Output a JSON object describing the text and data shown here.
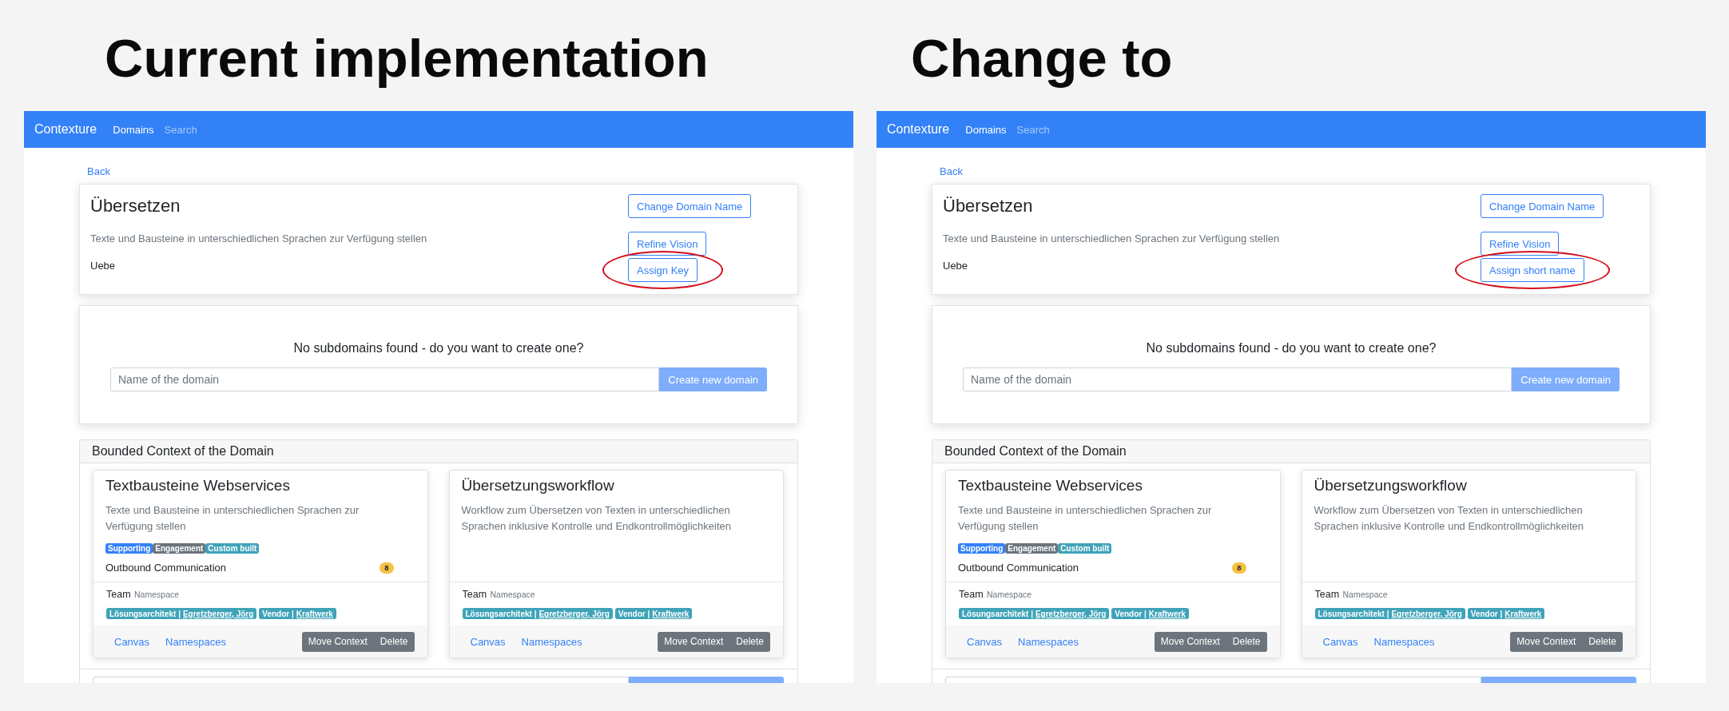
{
  "panels": [
    {
      "heading": "Current implementation",
      "app": {
        "navbar": {
          "brand": "Contexture",
          "links": [
            {
              "label": "Domains",
              "selected": true
            },
            {
              "label": "Search",
              "selected": false
            }
          ]
        },
        "back_link": "Back",
        "domain": {
          "name": "Übersetzen",
          "vision": "Texte und Bausteine in unterschiedlichen Sprachen zur Verfügung stellen",
          "key": "Uebe",
          "actions": [
            {
              "label": "Change Domain Name",
              "highlighted": false
            },
            {
              "label": "Refine Vision",
              "highlighted": false
            },
            {
              "label": "Assign Key",
              "highlighted": true
            }
          ]
        },
        "subdomains": {
          "message": "No subdomains found - do you want to create one?",
          "input": {
            "placeholder": "Name of the domain"
          },
          "create_button": "Create new domain"
        },
        "bounded_contexts": {
          "title": "Bounded Context of the Domain",
          "cards": [
            {
              "name": "Textbausteine Webservices",
              "description": "Texte und Bausteine in unterschiedlichen Sprachen zur Verfügung stellen",
              "badges": [
                {
                  "label": "Supporting",
                  "color": "#3381f7"
                },
                {
                  "label": "Engagement",
                  "color": "#6c757d"
                },
                {
                  "label": "Custom built",
                  "color": "#3fa3b8"
                }
              ],
              "messages": [
                {
                  "label": "Outbound Communication",
                  "count": "8"
                }
              ],
              "team": {
                "label": "Team",
                "caption": "Namespace"
              },
              "namespaces": [
                {
                  "label": "Lösungsarchitekt |",
                  "link": "Egretzberger, Jörg"
                },
                {
                  "label": "Vendor |",
                  "link": "Kraftwerk"
                }
              ],
              "links": [
                "Canvas",
                "Namespaces"
              ],
              "buttons": [
                "Move Context",
                "Delete"
              ]
            },
            {
              "name": "Übersetzungsworkflow",
              "description": "Workflow zum Übersetzen von Texten in unterschiedlichen Sprachen inklusive Kontrolle und Endkontrollmöglichkeiten",
              "team": {
                "label": "Team",
                "caption": "Namespace"
              },
              "namespaces": [
                {
                  "label": "Lösungsarchitekt |",
                  "link": "Egretzberger, Jörg"
                },
                {
                  "label": "Vendor |",
                  "link": "Kraftwerk"
                }
              ],
              "links": [
                "Canvas",
                "Namespaces"
              ],
              "buttons": [
                "Move Context",
                "Delete"
              ]
            }
          ]
        }
      }
    },
    {
      "heading": "Change to",
      "app": {
        "navbar": {
          "brand": "Contexture",
          "links": [
            {
              "label": "Domains",
              "selected": true
            },
            {
              "label": "Search",
              "selected": false
            }
          ]
        },
        "back_link": "Back",
        "domain": {
          "name": "Übersetzen",
          "vision": "Texte und Bausteine in unterschiedlichen Sprachen zur Verfügung stellen",
          "key": "Uebe",
          "actions": [
            {
              "label": "Change Domain Name",
              "highlighted": false
            },
            {
              "label": "Refine Vision",
              "highlighted": false
            },
            {
              "label": "Assign short name",
              "highlighted": true
            }
          ]
        },
        "subdomains": {
          "message": "No subdomains found - do you want to create one?",
          "input": {
            "placeholder": "Name of the domain"
          },
          "create_button": "Create new domain"
        },
        "bounded_contexts": {
          "title": "Bounded Context of the Domain",
          "cards": [
            {
              "name": "Textbausteine Webservices",
              "description": "Texte und Bausteine in unterschiedlichen Sprachen zur Verfügung stellen",
              "badges": [
                {
                  "label": "Supporting",
                  "color": "#3381f7"
                },
                {
                  "label": "Engagement",
                  "color": "#6c757d"
                },
                {
                  "label": "Custom built",
                  "color": "#3fa3b8"
                }
              ],
              "messages": [
                {
                  "label": "Outbound Communication",
                  "count": "8"
                }
              ],
              "team": {
                "label": "Team",
                "caption": "Namespace"
              },
              "namespaces": [
                {
                  "label": "Lösungsarchitekt |",
                  "link": "Egretzberger, Jörg"
                },
                {
                  "label": "Vendor |",
                  "link": "Kraftwerk"
                }
              ],
              "links": [
                "Canvas",
                "Namespaces"
              ],
              "buttons": [
                "Move Context",
                "Delete"
              ]
            },
            {
              "name": "Übersetzungsworkflow",
              "description": "Workflow zum Übersetzen von Texten in unterschiedlichen Sprachen inklusive Kontrolle und Endkontrollmöglichkeiten",
              "team": {
                "label": "Team",
                "caption": "Namespace"
              },
              "namespaces": [
                {
                  "label": "Lösungsarchitekt |",
                  "link": "Egretzberger, Jörg"
                },
                {
                  "label": "Vendor |",
                  "link": "Kraftwerk"
                }
              ],
              "links": [
                "Canvas",
                "Namespaces"
              ],
              "buttons": [
                "Move Context",
                "Delete"
              ]
            }
          ]
        }
      }
    }
  ]
}
